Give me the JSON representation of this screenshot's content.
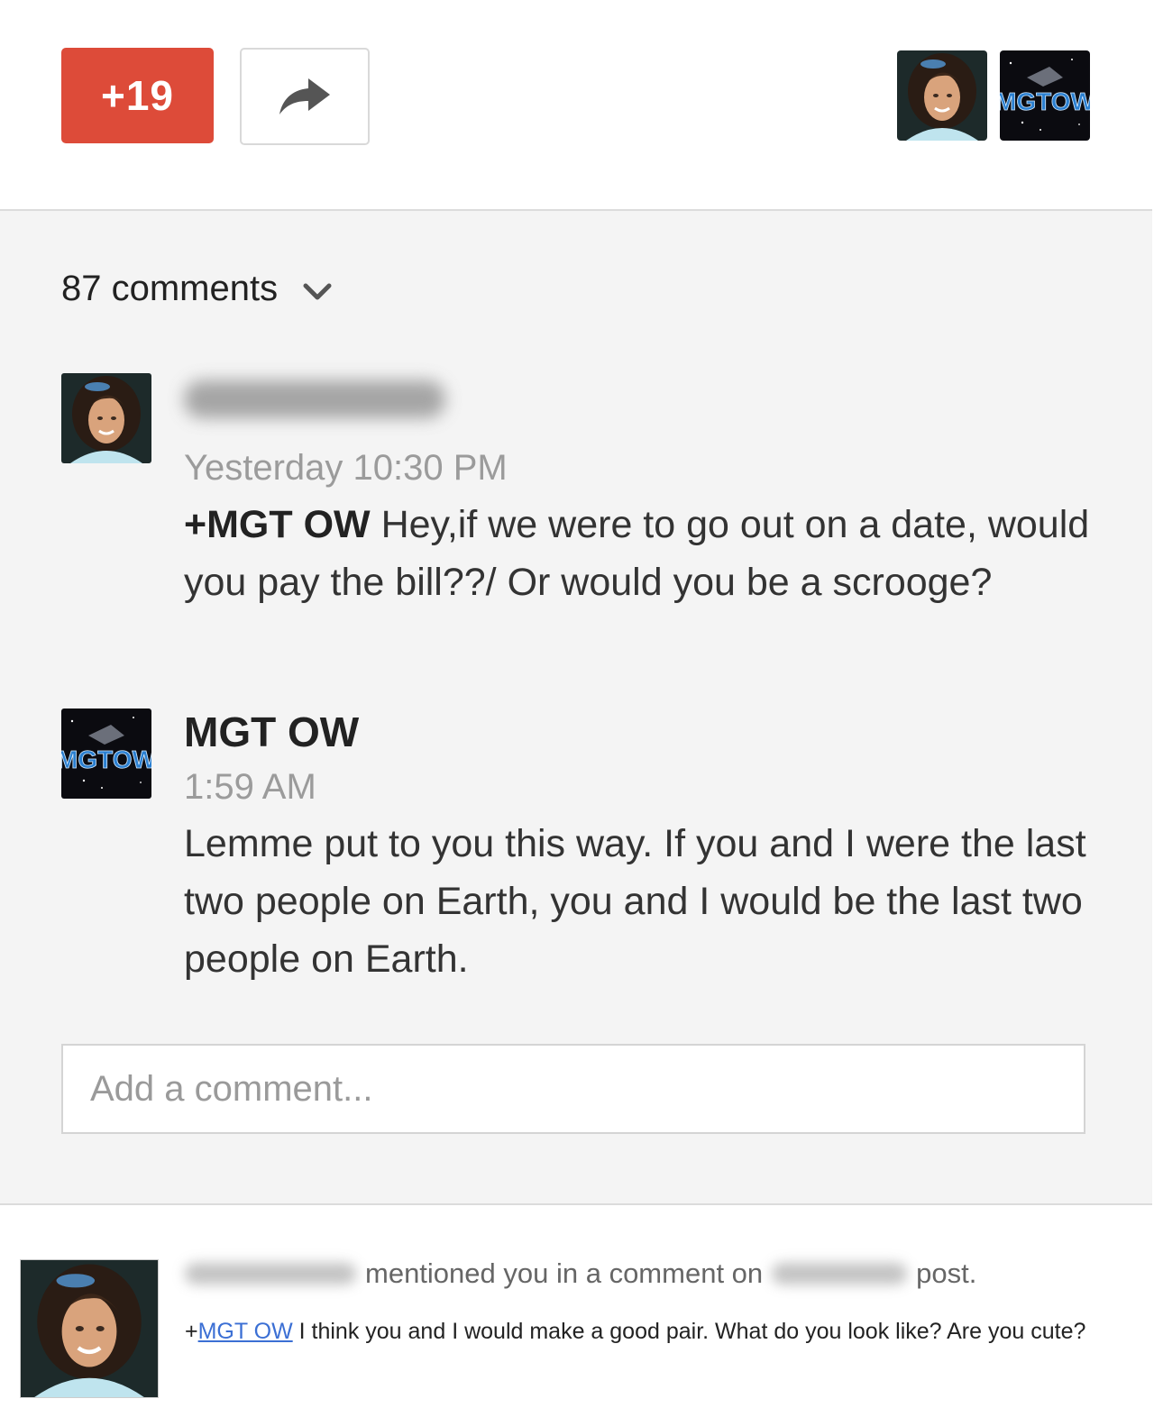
{
  "toolbar": {
    "plus_count": "+19",
    "brand_color": "#dd4b39"
  },
  "header_avatars": [
    "woman-profile-photo",
    "mgtow-logo"
  ],
  "comments_header": {
    "count_label": "87 comments"
  },
  "comments": [
    {
      "author_hidden": true,
      "timestamp": "Yesterday 10:30 PM",
      "mention": "+MGT OW",
      "text": " Hey,if we were to go out on a date, would you pay the bill??/ Or would you be a scrooge?"
    },
    {
      "author": "MGT OW",
      "timestamp": "1:59 AM",
      "text": "Lemme put to you this way. If you and I were the last two people on Earth, you and I would be the last two people on Earth."
    }
  ],
  "add_comment": {
    "placeholder": "Add a comment..."
  },
  "avatar_logo_text": "MGTOW",
  "notification": {
    "mentioned_text": "mentioned you in a comment on",
    "post_suffix": "post.",
    "plus_prefix": "+",
    "mention_link": "MGT OW",
    "message": " I think you and I would make a good pair. What do you look like? Are you cute?",
    "link_color": "#3b6fd4"
  }
}
